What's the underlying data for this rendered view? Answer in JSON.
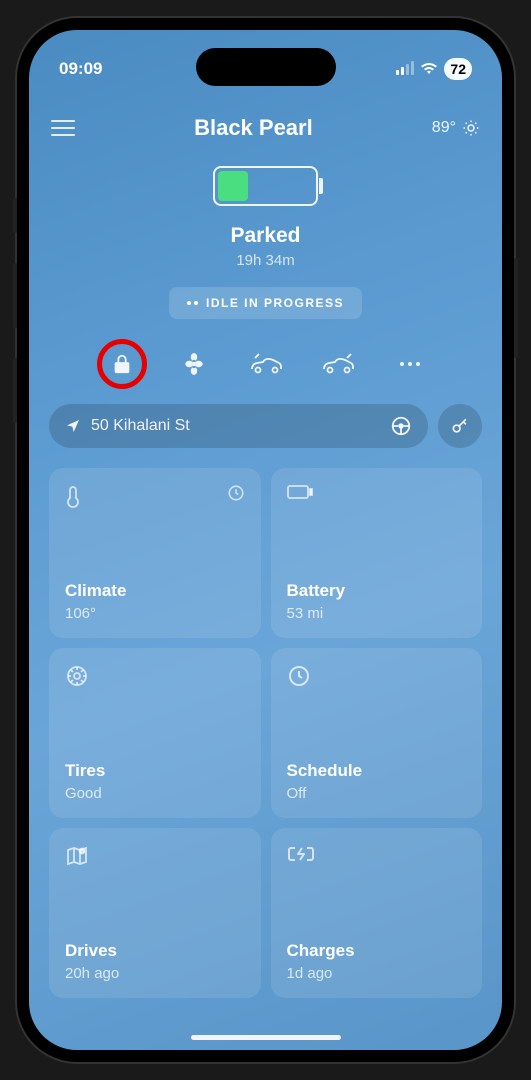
{
  "status_bar": {
    "time": "09:09",
    "battery_pct": "72"
  },
  "header": {
    "title": "Black Pearl",
    "temp": "89°"
  },
  "vehicle": {
    "state": "Parked",
    "duration": "19h 34m",
    "idle_label": "IDLE IN PROGRESS"
  },
  "address": {
    "text": "50 Kihalani St"
  },
  "cards": {
    "climate": {
      "title": "Climate",
      "sub": "106°"
    },
    "battery": {
      "title": "Battery",
      "sub": "53 mi"
    },
    "tires": {
      "title": "Tires",
      "sub": "Good"
    },
    "schedule": {
      "title": "Schedule",
      "sub": "Off"
    },
    "drives": {
      "title": "Drives",
      "sub": "20h ago"
    },
    "charges": {
      "title": "Charges",
      "sub": "1d ago"
    }
  }
}
